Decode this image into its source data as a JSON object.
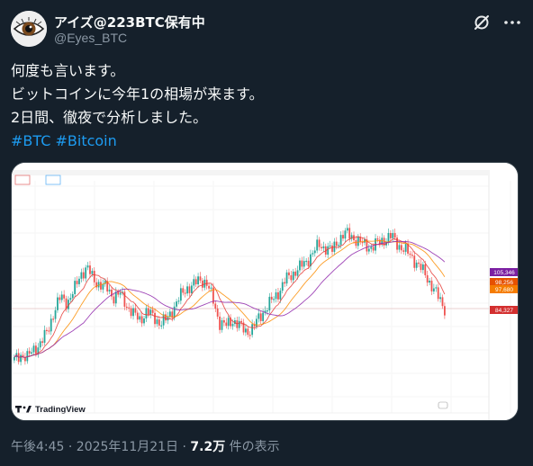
{
  "author": {
    "display_name": "アイズ@223BTC保有中",
    "handle": "@Eyes_BTC"
  },
  "icons": {
    "avatar": "eye-avatar",
    "grok": "grok-icon",
    "more": "more-icon"
  },
  "tweet": {
    "lines": [
      "何度も言います。",
      "ビットコインに今年1の相場が来ます。",
      "2日間、徹夜で分析しました。"
    ],
    "hashtags": [
      "#BTC",
      "#Bitcoin"
    ]
  },
  "chart_data": {
    "type": "line",
    "logo": "TradingView",
    "price_tags": [
      "105,346",
      "98,256",
      "97,680",
      "84,327"
    ],
    "tag_colors": [
      "#7b1fa2",
      "#e65100",
      "#f57c00",
      "#d32f2f"
    ],
    "candle_colors": {
      "up": "#26a69a",
      "down": "#ef5350"
    },
    "ma_colors": [
      "#e53935",
      "#fb8c00",
      "#8e24aa"
    ],
    "series_y": [
      78,
      80,
      79,
      82,
      84,
      88,
      95,
      100,
      98,
      102,
      108,
      110,
      106,
      104,
      103,
      100,
      101,
      97,
      94,
      92,
      95,
      93,
      91,
      92,
      96,
      100,
      103,
      104,
      106,
      105,
      99,
      91,
      90,
      92,
      90,
      88,
      89,
      93,
      96,
      99,
      102,
      106,
      108,
      110,
      112,
      115,
      118,
      117,
      116,
      120,
      122,
      121,
      119,
      118,
      117,
      119,
      120,
      121,
      118,
      116,
      114,
      111,
      108,
      104,
      100,
      96
    ]
  },
  "meta": {
    "time": "午後4:45 · 2025年11月21日 · ",
    "views": "7.2万",
    "views_label": " 件の表示"
  },
  "colors": {
    "background": "#15202b",
    "text": "#f7f9f9",
    "secondary": "#8b98a5",
    "link": "#1d9bf0"
  }
}
